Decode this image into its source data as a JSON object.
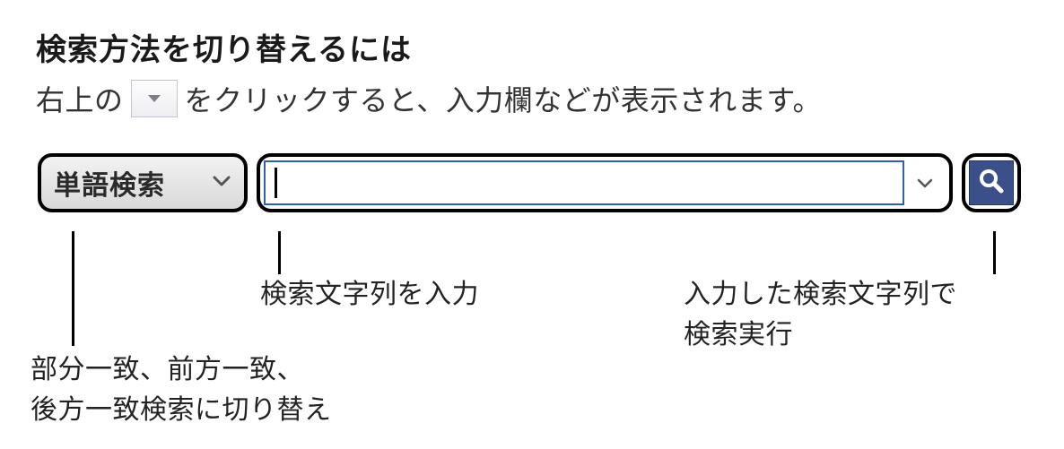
{
  "heading": "検索方法を切り替えるには",
  "intro": {
    "before": "右上の",
    "after": "をクリックすると、入力欄などが表示されます。"
  },
  "search": {
    "mode_label": "単語検索",
    "input_value": "",
    "placeholder": ""
  },
  "callouts": {
    "mode": "部分一致、前方一致、\n後方一致検索に切り替え",
    "input": "検索文字列を入力",
    "search": "入力した検索文字列で\n検索実行"
  }
}
